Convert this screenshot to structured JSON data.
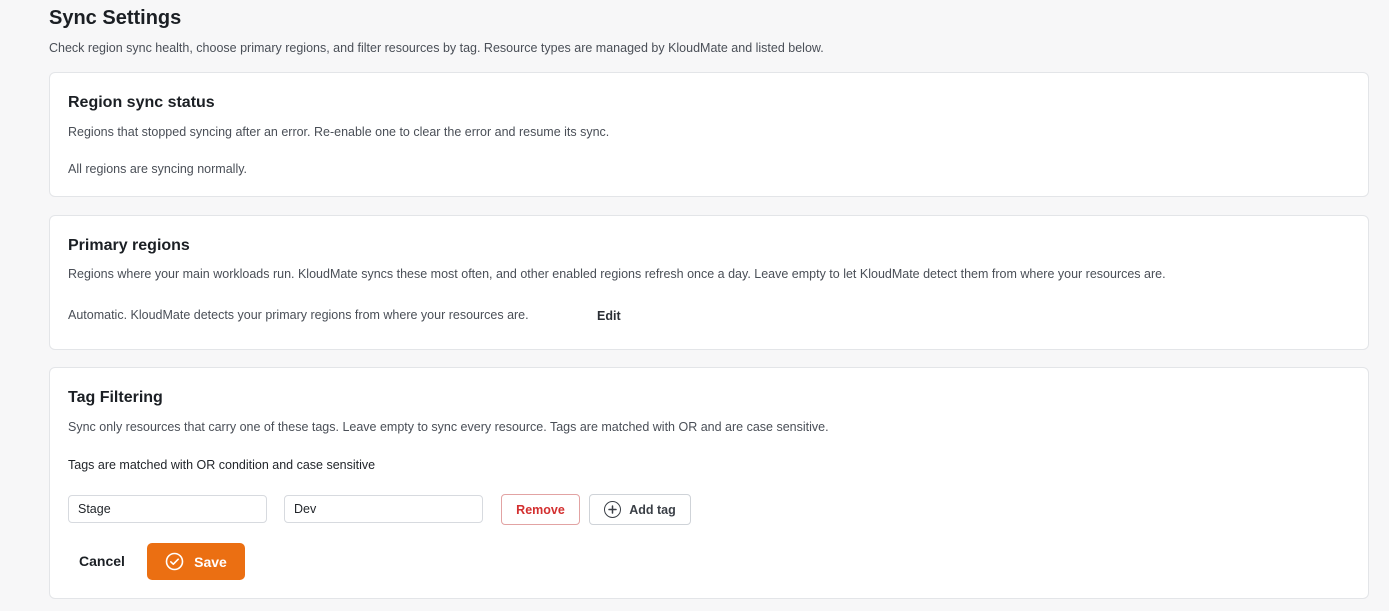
{
  "page": {
    "title": "Sync Settings",
    "subtitle": "Check region sync health, choose primary regions, and filter resources by tag. Resource types are managed by KloudMate and listed below."
  },
  "region_sync": {
    "title": "Region sync status",
    "description": "Regions that stopped syncing after an error. Re-enable one to clear the error and resume its sync.",
    "status_text": "All regions are syncing normally."
  },
  "primary_regions": {
    "title": "Primary regions",
    "description": "Regions where your main workloads run. KloudMate syncs these most often, and other enabled regions refresh once a day. Leave empty to let KloudMate detect them from where your resources are.",
    "current_mode": "Automatic. KloudMate detects your primary regions from where your resources are.",
    "edit_label": "Edit"
  },
  "tag_filtering": {
    "title": "Tag Filtering",
    "description": "Sync only resources that carry one of these tags. Leave empty to sync every resource. Tags are matched with OR and are case sensitive.",
    "match_note": "Tags are matched with OR condition and case sensitive",
    "tags": [
      {
        "key": "Stage",
        "value": "Dev"
      }
    ],
    "remove_label": "Remove",
    "add_tag_label": "Add tag",
    "cancel_label": "Cancel",
    "save_label": "Save",
    "accent_color": "#eb6f12",
    "danger_color": "#d32f2f",
    "icons": {
      "add": "plus-circle-icon",
      "save": "check-circle-icon"
    }
  }
}
